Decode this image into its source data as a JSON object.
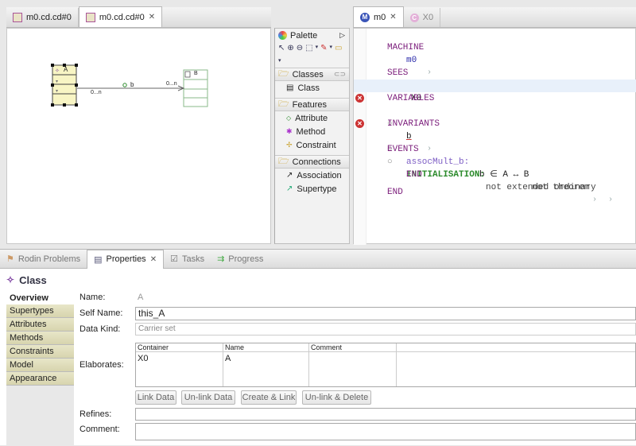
{
  "left_tabs": [
    {
      "label": "m0.cd.cd#0"
    },
    {
      "label": "m0.cd.cd#0"
    }
  ],
  "right_tabs": [
    {
      "label": "m0"
    },
    {
      "label": "X0"
    }
  ],
  "diagram": {
    "class_a": {
      "name": "A"
    },
    "class_b": {
      "name": "B"
    },
    "association": {
      "label": "b",
      "source_mult": "0...n",
      "target_mult": "0...n"
    }
  },
  "palette": {
    "title": "Palette",
    "drawers": [
      {
        "label": "Classes",
        "items": [
          "Class"
        ]
      },
      {
        "label": "Features",
        "items": [
          "Attribute",
          "Method",
          "Constraint"
        ]
      },
      {
        "label": "Connections",
        "items": [
          "Association",
          "Supertype"
        ]
      }
    ]
  },
  "editor": {
    "machine_kw": "MACHINE",
    "machine_name": "m0",
    "sees_kw": "SEES",
    "sees_ctx": "X0",
    "variables_kw": "VARIABLES",
    "variable": "b",
    "invariants_kw": "INVARIANTS",
    "inv_label": "assocMult_b:",
    "inv_pred": "b ∈ A ↔ B",
    "inv_status": "not theorem",
    "events_kw": "EVENTS",
    "event_name": "INITIALISATION:",
    "event_status": "not extended ordinary",
    "end1": "END",
    "end2": "END"
  },
  "bottom_tabs": [
    {
      "label": "Rodin Problems"
    },
    {
      "label": "Properties"
    },
    {
      "label": "Tasks"
    },
    {
      "label": "Progress"
    }
  ],
  "properties": {
    "heading": "Class",
    "sections": [
      "Overview",
      "Supertypes",
      "Attributes",
      "Methods",
      "Constraints",
      "Model",
      "Appearance"
    ],
    "name_label": "Name:",
    "name_value": "A",
    "self_name_label": "Self Name:",
    "self_name_value": "this_A",
    "data_kind_label": "Data Kind:",
    "data_kind_value": "Carrier set",
    "elaborates_label": "Elaborates:",
    "table_headers": [
      "Container",
      "Name",
      "Comment"
    ],
    "table_rows": [
      [
        "X0",
        "A",
        ""
      ]
    ],
    "buttons": [
      "Link Data",
      "Un-link Data",
      "Create & Link",
      "Un-link & Delete"
    ],
    "refines_label": "Refines:",
    "comment_label": "Comment:"
  },
  "colors": {
    "keyword": "#7b1d7b",
    "identifier": "#2a2aaa",
    "label": "#2b8a2b",
    "error": "#cc3333",
    "class_fill": "#f8f5c4"
  }
}
